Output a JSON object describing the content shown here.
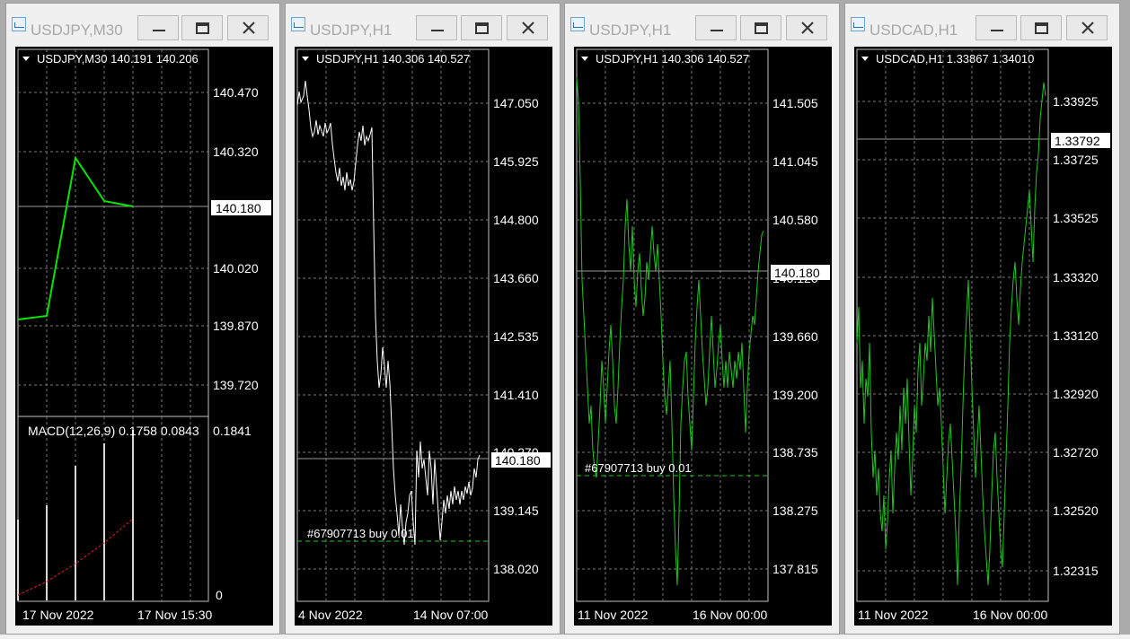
{
  "windows": [
    {
      "title": "USDJPY,M30",
      "header": "USDJPY,M30  140.191 140.206",
      "price_labels": [
        "140.470",
        "140.320",
        "140.020",
        "139.870",
        "139.720"
      ],
      "current_price": "140.180",
      "date_left": "17 Nov 2022",
      "date_right": "17 Nov 15:30",
      "macd_label": "MACD(12,26,9) 0.1758 0.0843",
      "macd_top": "0.1841",
      "macd_zero": "0",
      "line_color": "#00e600"
    },
    {
      "title": "USDJPY,H1",
      "header": "USDJPY,H1  140.306 140.527",
      "price_labels": [
        "147.050",
        "145.925",
        "144.800",
        "143.660",
        "142.535",
        "141.410",
        "140.270",
        "139.145",
        "138.020"
      ],
      "current_price": "140.180",
      "order_label": "#67907713 buy 0.01",
      "date_left": "4 Nov 2022",
      "date_right": "14 Nov 07:00",
      "line_color": "#ffffff"
    },
    {
      "title": "USDJPY,H1",
      "header": "USDJPY,H1  140.306 140.527",
      "price_labels": [
        "141.505",
        "141.045",
        "140.580",
        "140.120",
        "139.660",
        "139.200",
        "138.735",
        "138.275",
        "137.815"
      ],
      "current_price": "140.180",
      "order_label": "#67907713 buy 0.01",
      "date_left": "11 Nov 2022",
      "date_right": "16 Nov 00:00",
      "line_color": "#1ec81e"
    },
    {
      "title": "USDCAD,H1",
      "header": "USDCAD,H1  1.33867 1.34010",
      "price_labels": [
        "1.33925",
        "1.33725",
        "1.33525",
        "1.33320",
        "1.33120",
        "1.32920",
        "1.32720",
        "1.32520",
        "1.32315"
      ],
      "current_price": "1.33792",
      "date_left": "11 Nov 2022",
      "date_right": "16 Nov 00:00",
      "line_color": "#1ec81e"
    }
  ]
}
